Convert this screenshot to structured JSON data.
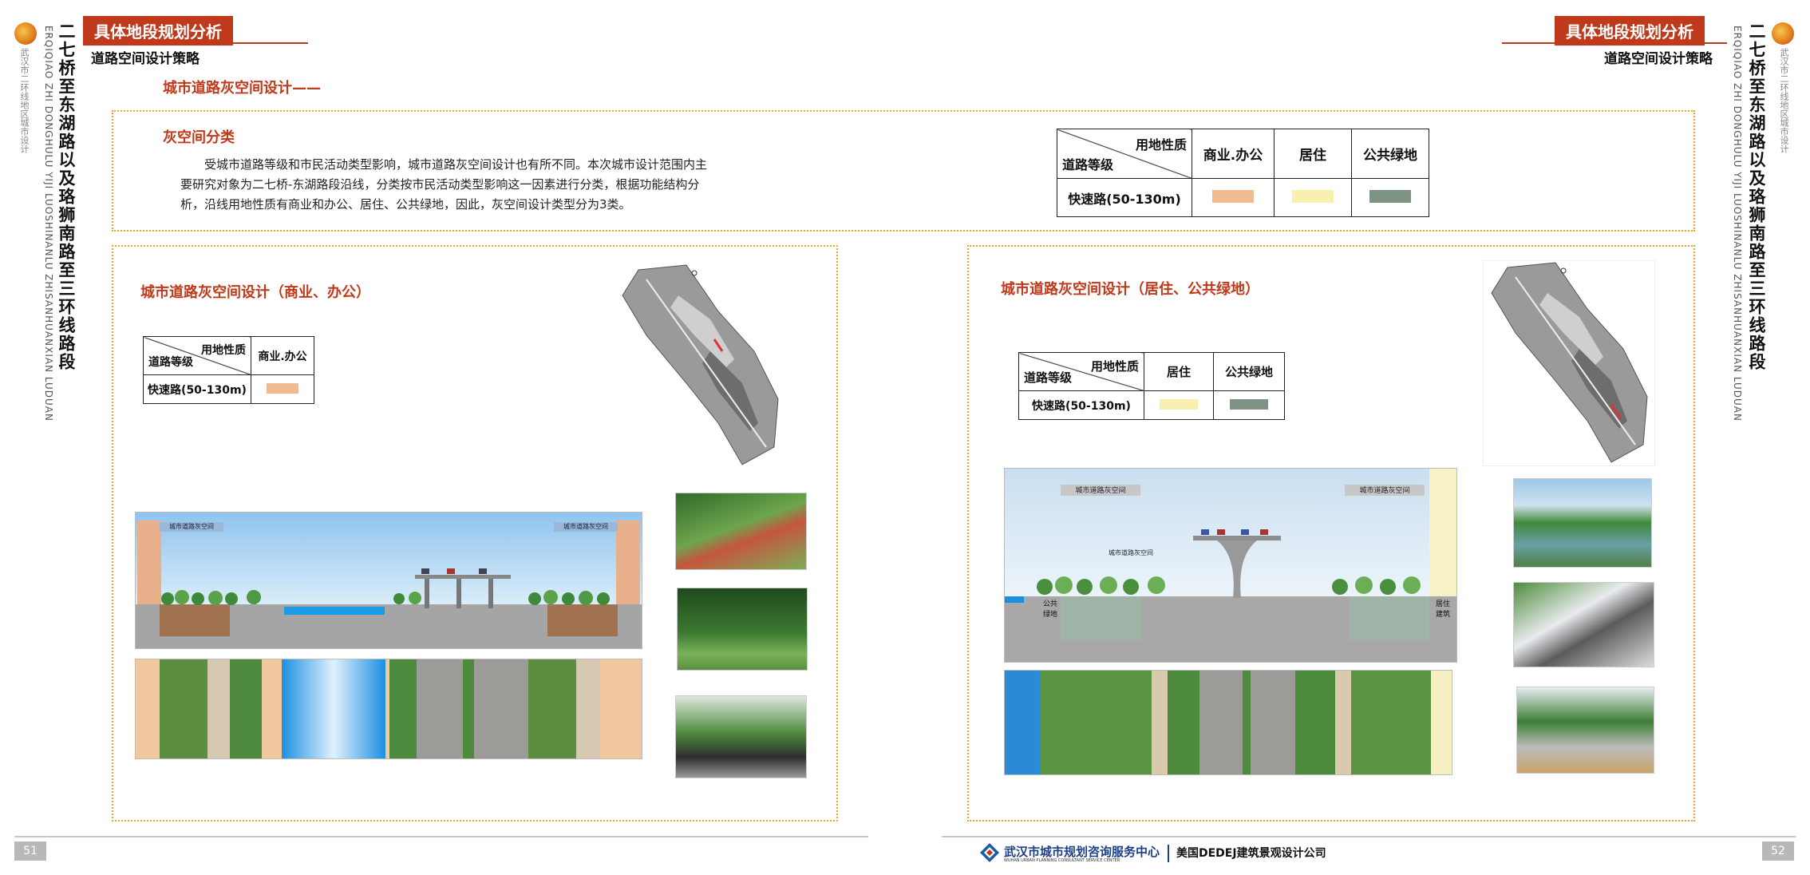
{
  "left_page": {
    "badge": "具体地段规划分析",
    "subtitle": "道路空间设计策略",
    "section_title": "城市道路灰空间设计——",
    "vertical_title": "二七桥至东湖路以及珞狮南路至三环线路段",
    "vertical_pinyin": "ERQIQIAO ZHI DONGHULU YIJI LUOSHINANLU ZHISANHUANXIAN LUDUAN",
    "vertical_org": "武汉市二环线地区城市设计",
    "page_number": "51"
  },
  "right_page": {
    "badge": "具体地段规划分析",
    "subtitle": "道路空间设计策略",
    "vertical_title": "二七桥至东湖路以及珞狮南路至三环线路段",
    "vertical_pinyin": "ERQIQIAO ZHI DONGHULU YIJI LUOSHINANLU ZHISANHUANXIAN LUDUAN",
    "vertical_org": "武汉市二环线地区城市设计",
    "page_number": "52"
  },
  "classification": {
    "title": "灰空间分类",
    "paragraph_line1": "受城市道路等级和市民活动类型影响，城市道路灰空间设计也有所不同。本次城市设计范围内主",
    "paragraph_line2": "要研究对象为二七桥-东湖路段沿线，分类按市民活动类型影响这一因素进行分类，根据功能结构分",
    "paragraph_line3": "析，沿线用地性质有商业和办公、居住、公共绿地，因此，灰空间设计类型分为3类。",
    "table": {
      "header_top": "用地性质",
      "header_bottom": "道路等级",
      "columns": [
        "商业.办公",
        "居住",
        "公共绿地"
      ],
      "row_label": "快速路(50-130m)"
    }
  },
  "panel_commercial": {
    "title": "城市道路灰空间设计（商业、办公）",
    "table": {
      "header_top": "用地性质",
      "header_bottom": "道路等级",
      "columns": [
        "商业.办公"
      ],
      "row_label": "快速路(50-130m)"
    },
    "section_label_left": "城市道路灰空间",
    "section_label_right": "城市道路灰空间"
  },
  "panel_residential": {
    "title": "城市道路灰空间设计（居住、公共绿地）",
    "table": {
      "header_top": "用地性质",
      "header_bottom": "道路等级",
      "columns": [
        "居住",
        "公共绿地"
      ],
      "row_label": "快速路(50-130m)"
    },
    "section_label_left": "城市道路灰空间",
    "section_label_right": "城市道路灰空间",
    "section_label_mid": "城市道路灰空间",
    "edge_label_left": "公共绿地",
    "edge_label_right": "居住建筑"
  },
  "footer": {
    "org_cn": "武汉市城市规划咨询服务中心",
    "org_en": "WUHAN URBAN PLANNING CONSULTANT SERVICE CENTER",
    "partner": "美国DEDEJ建筑景观设计公司"
  },
  "colors": {
    "accent": "#c0391b",
    "dash": "#f2a327",
    "commercial": "#f0bb8e",
    "residential": "#f8f0b0",
    "green": "#7f9384"
  }
}
